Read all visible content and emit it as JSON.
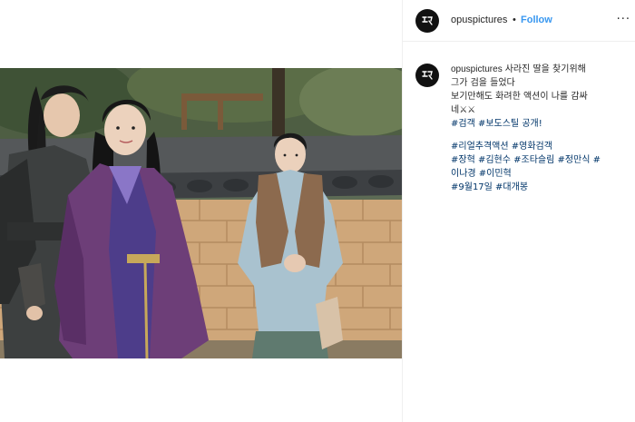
{
  "post": {
    "username": "opuspictures",
    "separator": "•",
    "follow_label": "Follow",
    "more_label": "···",
    "avatar_icon": "seal-logo-icon",
    "caption": {
      "username": "opuspictures",
      "line1": "사라진 딸을 찾기위해",
      "line2": "그가 검을 들었다",
      "line3": "보기만해도 화려한 액션이 나를 감싸",
      "line4": "네",
      "line4_emoji": "⚔⚔",
      "line5": "#검객 #보도스틸 공개!",
      "tags_line1": "#리얼추격액션 #영화검객",
      "tags_line2": "#장혁 #김현수 #조타슬림 #정만식 #",
      "tags_line3": "이나경 #이민혁",
      "tags_line4": "#9월17일 #대개봉"
    }
  },
  "colors": {
    "link": "#003569",
    "follow": "#3897f0",
    "border": "#efefef"
  }
}
